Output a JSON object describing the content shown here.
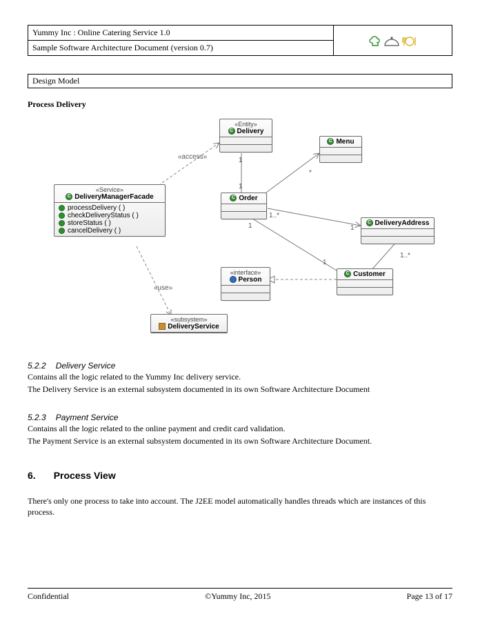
{
  "header": {
    "title": "Yummy Inc : Online Catering Service 1.0",
    "subtitle": "Sample Software Architecture Document (version 0.7)"
  },
  "section_box": "Design Model",
  "section_title": "Process Delivery",
  "uml": {
    "facade": {
      "stereo": "«Service»",
      "name": "DeliveryManagerFacade",
      "ops": [
        "processDelivery ( )",
        "checkDeliveryStatus ( )",
        "storeStatus ( )",
        "cancelDelivery ( )"
      ]
    },
    "delivery": {
      "stereo": "«Entity»",
      "name": "Delivery"
    },
    "menu": {
      "name": "Menu"
    },
    "order": {
      "name": "Order"
    },
    "address": {
      "name": "DeliveryAddress"
    },
    "customer": {
      "name": "Customer"
    },
    "person": {
      "stereo": "«interface»",
      "name": "Person"
    },
    "subsystem": {
      "stereo": "«subsystem»",
      "name": "DeliveryService"
    },
    "labels": {
      "access": "«access»",
      "use": "«use»",
      "one_a": "1",
      "one_b": "1",
      "one_c": "1",
      "one_d": "1",
      "one_e": "1",
      "star": "*",
      "one_many_a": "1..*",
      "one_many_b": "1..*"
    }
  },
  "para522": {
    "heading_num": "5.2.2",
    "heading": "Delivery Service",
    "l1": "Contains all the logic related to the Yummy Inc delivery service.",
    "l2": "The Delivery Service is an external subsystem documented in its own Software Architecture Document"
  },
  "para523": {
    "heading_num": "5.2.3",
    "heading": "Payment Service",
    "l1": "Contains all the logic related to the online payment and credit card validation.",
    "l2": "The Payment Service is an external subsystem documented in its own Software Architecture Document."
  },
  "sec6": {
    "num": "6.",
    "title": "Process View",
    "body": "There's only one process to take into account. The J2EE model automatically handles threads which are instances of this process."
  },
  "footer": {
    "left": "Confidential",
    "center": "©Yummy Inc, 2015",
    "right": "Page 13 of 17"
  }
}
